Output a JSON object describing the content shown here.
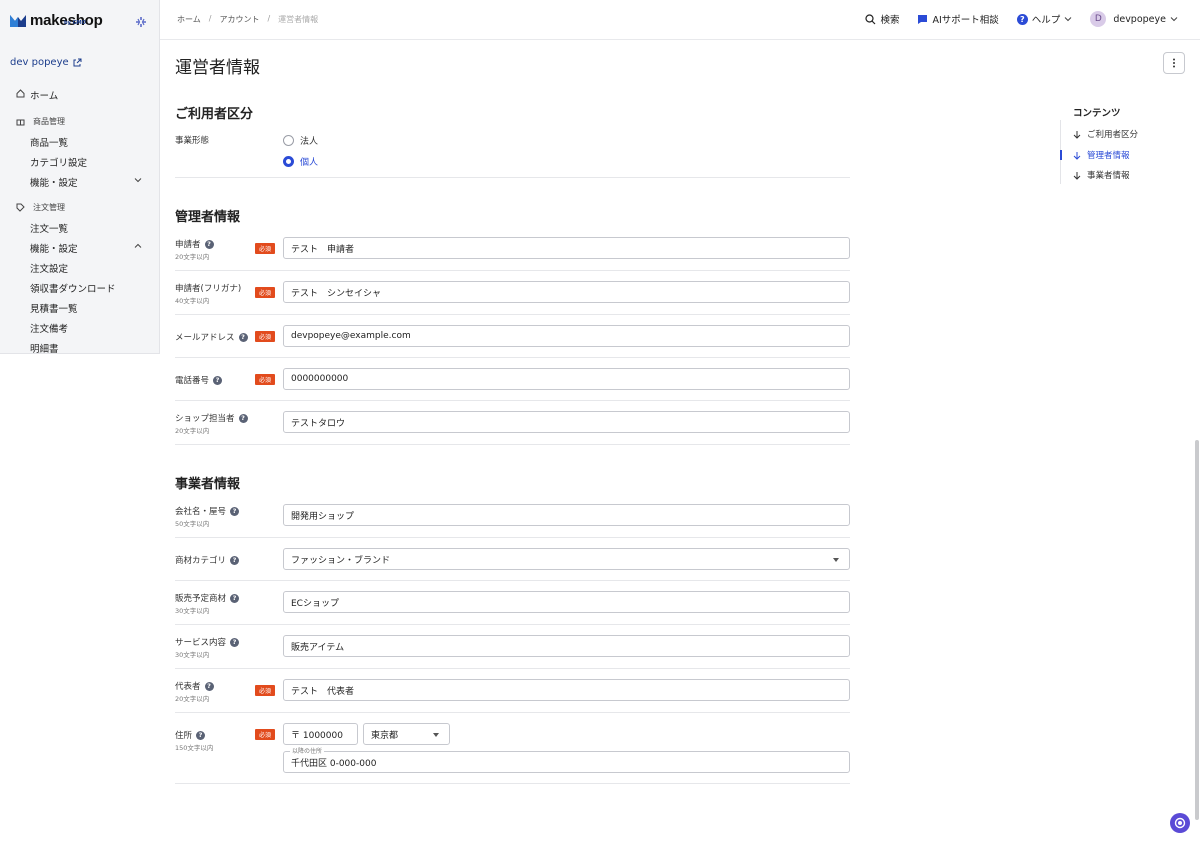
{
  "app": {
    "logo_text": "makeshop",
    "logo_sub": "by GMO",
    "shop_name": "dev popeye"
  },
  "colors": {
    "accent": "#2b4bd6",
    "required": "#e24b1d",
    "brand": "#1c3d8c"
  },
  "sidebar": {
    "home": "ホーム",
    "product_section": "商品管理",
    "product_items": [
      "商品一覧",
      "カテゴリ設定",
      "機能・設定"
    ],
    "order_section": "注文管理",
    "order_items": [
      "注文一覧",
      "機能・設定",
      "注文設定",
      "領収書ダウンロード",
      "見積書一覧",
      "注文備考",
      "明細書"
    ]
  },
  "breadcrumb": [
    "ホーム",
    "アカウント",
    "運営者情報"
  ],
  "topbar": {
    "search": "検索",
    "ai": "AIサポート相談",
    "help": "ヘルプ",
    "user": "devpopeye",
    "avatar_initial": "D"
  },
  "page": {
    "title": "運営者情報"
  },
  "required_label": "必須",
  "section1": {
    "title": "ご利用者区分",
    "label": "事業形態",
    "options": [
      "法人",
      "個人"
    ],
    "selected": "個人"
  },
  "section2": {
    "title": "管理者情報",
    "rows": [
      {
        "label": "申請者",
        "sub": "20文字以内",
        "value": "テスト　申請者"
      },
      {
        "label": "申請者(フリガナ)",
        "sub": "40文字以内",
        "value": "テスト　シンセイシャ"
      },
      {
        "label": "メールアドレス",
        "sub": "",
        "value": "devpopeye@example.com"
      },
      {
        "label": "電話番号",
        "sub": "",
        "value": "0000000000"
      },
      {
        "label": "ショップ担当者",
        "sub": "20文字以内",
        "value": "テストタロウ"
      }
    ]
  },
  "section3": {
    "title": "事業者情報",
    "rows": [
      {
        "label": "会社名・屋号",
        "sub": "50文字以内",
        "value": "開発用ショップ"
      },
      {
        "label": "商材カテゴリ",
        "sub": "",
        "value": "ファッション・ブランド"
      },
      {
        "label": "販売予定商材",
        "sub": "30文字以内",
        "value": "ECショップ"
      },
      {
        "label": "サービス内容",
        "sub": "30文字以内",
        "value": "販売アイテム"
      },
      {
        "label": "代表者",
        "sub": "20文字以内",
        "value": "テスト　代表者"
      },
      {
        "label": "住所",
        "sub": "150文字以内",
        "postal": "〒 1000000",
        "prefecture": "東京都",
        "address_caption": "以降の住所",
        "address": "千代田区 0-000-000"
      }
    ]
  },
  "toc": {
    "title": "コンテンツ",
    "items": [
      "ご利用者区分",
      "管理者情報",
      "事業者情報"
    ],
    "active": "管理者情報"
  }
}
